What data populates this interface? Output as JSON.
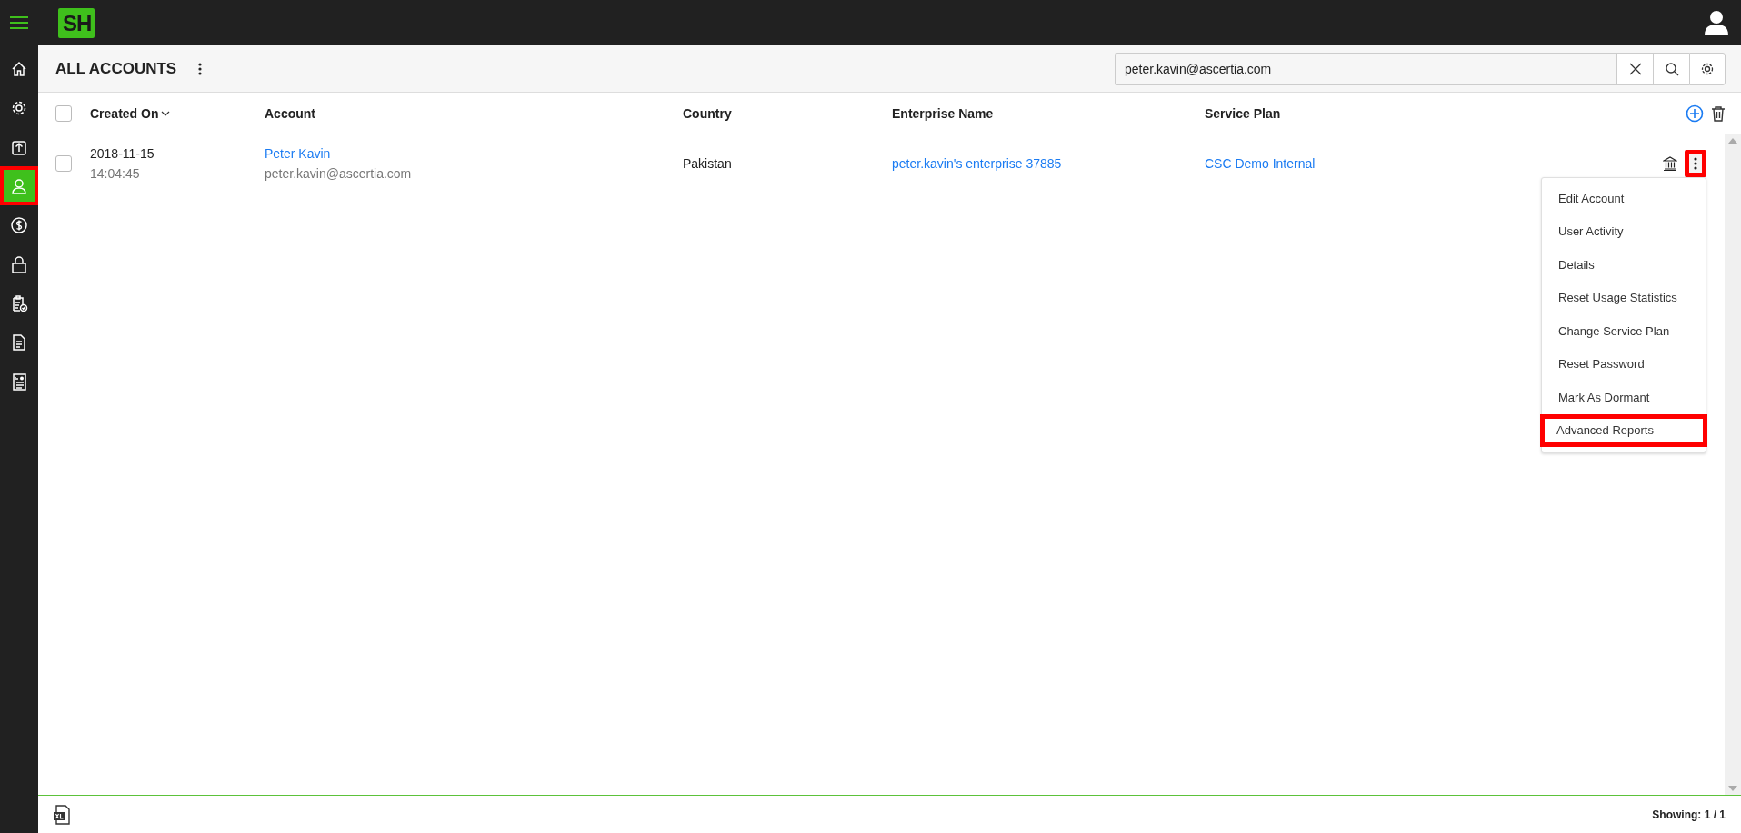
{
  "app": {
    "logo": "SH"
  },
  "sidebar": {
    "items": [
      {
        "selected": false,
        "highlighted": false
      },
      {
        "selected": false,
        "highlighted": false
      },
      {
        "selected": false,
        "highlighted": false
      },
      {
        "selected": true,
        "highlighted": true
      },
      {
        "selected": false,
        "highlighted": false
      },
      {
        "selected": false,
        "highlighted": false
      },
      {
        "selected": false,
        "highlighted": false
      },
      {
        "selected": false,
        "highlighted": false
      },
      {
        "selected": false,
        "highlighted": false
      }
    ]
  },
  "header": {
    "title": "ALL ACCOUNTS",
    "search": {
      "value": "peter.kavin@ascertia.com"
    }
  },
  "table": {
    "select_all_checked": false,
    "columns": [
      {
        "label": "Created On",
        "sorted": true
      },
      {
        "label": "Account",
        "sorted": false
      },
      {
        "label": "Country",
        "sorted": false
      },
      {
        "label": "Enterprise Name",
        "sorted": false
      },
      {
        "label": "Service Plan",
        "sorted": false
      }
    ],
    "rows": [
      {
        "selected": false,
        "created_date": "2018-11-15",
        "created_time": "14:04:45",
        "account_name": "Peter Kavin",
        "account_email": "peter.kavin@ascertia.com",
        "country": "Pakistan",
        "enterprise": "peter.kavin's enterprise 37885",
        "service_plan": "CSC Demo Internal",
        "menu_open": true,
        "menu_highlighted": true
      }
    ]
  },
  "context_menu": {
    "items": [
      {
        "label": "Edit Account",
        "highlighted": false
      },
      {
        "label": "User Activity",
        "highlighted": false
      },
      {
        "label": "Details",
        "highlighted": false
      },
      {
        "label": "Reset Usage Statistics",
        "highlighted": false
      },
      {
        "label": "Change Service Plan",
        "highlighted": false
      },
      {
        "label": "Reset Password",
        "highlighted": false
      },
      {
        "label": "Mark As Dormant",
        "highlighted": false
      },
      {
        "label": "Advanced Reports",
        "highlighted": true
      }
    ]
  },
  "footer": {
    "showing": "Showing: 1 / 1"
  }
}
